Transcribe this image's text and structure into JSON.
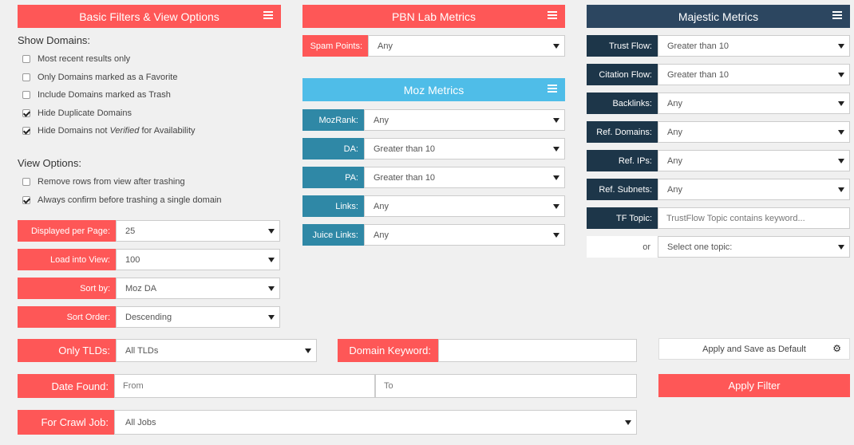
{
  "panels": {
    "basic": {
      "title": "Basic Filters & View Options"
    },
    "pbn": {
      "title": "PBN Lab Metrics"
    },
    "moz": {
      "title": "Moz Metrics"
    },
    "majestic": {
      "title": "Majestic Metrics"
    }
  },
  "show_domains": {
    "heading": "Show Domains:",
    "options": [
      {
        "label": "Most recent results only",
        "checked": false
      },
      {
        "label": "Only Domains marked as a Favorite",
        "checked": false
      },
      {
        "label": "Include Domains marked as Trash",
        "checked": false
      },
      {
        "label": "Hide Duplicate Domains",
        "checked": true
      },
      {
        "label_pre": "Hide Domains not ",
        "label_em": "Verified",
        "label_post": " for Availability",
        "checked": true
      }
    ]
  },
  "view_options": {
    "heading": "View Options:",
    "options": [
      {
        "label": "Remove rows from view after trashing",
        "checked": false
      },
      {
        "label": "Always confirm before trashing a single domain",
        "checked": true
      }
    ]
  },
  "basic_selects": [
    {
      "label": "Displayed per Page:",
      "value": "25"
    },
    {
      "label": "Load into View:",
      "value": "100"
    },
    {
      "label": "Sort by:",
      "value": "Moz DA"
    },
    {
      "label": "Sort Order:",
      "value": "Descending"
    }
  ],
  "pbn_selects": [
    {
      "label": "Spam Points:",
      "value": "Any"
    }
  ],
  "moz_selects": [
    {
      "label": "MozRank:",
      "value": "Any"
    },
    {
      "label": "DA:",
      "value": "Greater than 10"
    },
    {
      "label": "PA:",
      "value": "Greater than 10"
    },
    {
      "label": "Links:",
      "value": "Any"
    },
    {
      "label": "Juice Links:",
      "value": "Any"
    }
  ],
  "majestic_selects": [
    {
      "label": "Trust Flow:",
      "value": "Greater than 10"
    },
    {
      "label": "Citation Flow:",
      "value": "Greater than 10"
    },
    {
      "label": "Backlinks:",
      "value": "Any"
    },
    {
      "label": "Ref. Domains:",
      "value": "Any"
    },
    {
      "label": "Ref. IPs:",
      "value": "Any"
    },
    {
      "label": "Ref. Subnets:",
      "value": "Any"
    }
  ],
  "tf_topic": {
    "label": "TF Topic:",
    "placeholder": "TrustFlow Topic contains keyword..."
  },
  "topic_or": {
    "label": "or",
    "value": "Select one topic:"
  },
  "bottom": {
    "only_tlds": {
      "label": "Only TLDs:",
      "value": "All TLDs"
    },
    "domain_keyword": {
      "label": "Domain Keyword:",
      "value": ""
    },
    "date_found": {
      "label": "Date Found:",
      "from_placeholder": "From",
      "to_placeholder": "To"
    },
    "crawl_job": {
      "label": "For Crawl Job:",
      "value": "All Jobs"
    },
    "save_default": "Apply and Save as Default",
    "apply_filter": "Apply Filter"
  },
  "colors": {
    "red": "#fe5757",
    "blue": "#4fbde8",
    "navy": "#2c4660",
    "teal": "#2f88a6",
    "dark": "#1d3649"
  },
  "icons": [
    "list-icon",
    "caret-down-icon",
    "gear-icon",
    "checkbox-icon"
  ]
}
